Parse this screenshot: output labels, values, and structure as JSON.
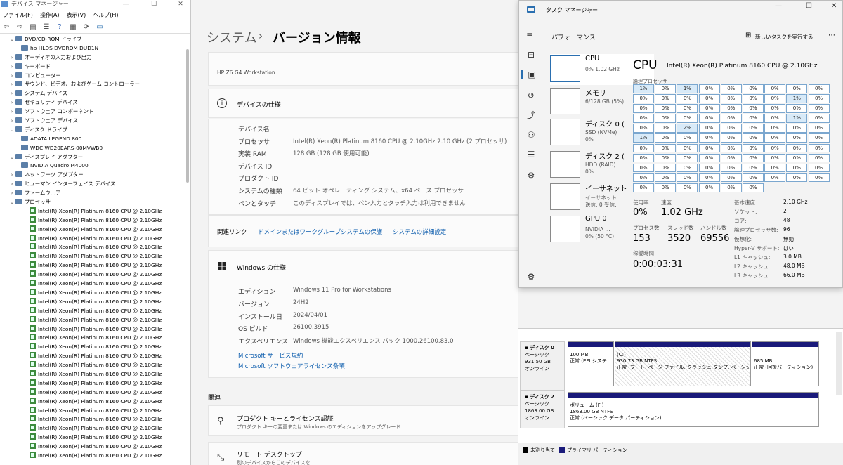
{
  "device_manager": {
    "title": "デバイス マネージャー",
    "menu": [
      "ファイル(F)",
      "操作(A)",
      "表示(V)",
      "ヘルプ(H)"
    ],
    "tree": [
      {
        "label": "DVD/CD-ROM ドライブ",
        "level": 0,
        "expanded": true
      },
      {
        "label": "hp HLDS DVDROM DUD1N",
        "level": 1
      },
      {
        "label": "オーディオの入力および出力",
        "level": 0
      },
      {
        "label": "キーボード",
        "level": 0
      },
      {
        "label": "コンピューター",
        "level": 0
      },
      {
        "label": "サウンド、ビデオ、およびゲーム コントローラー",
        "level": 0
      },
      {
        "label": "システム デバイス",
        "level": 0
      },
      {
        "label": "セキュリティ デバイス",
        "level": 0
      },
      {
        "label": "ソフトウェア コンポーネント",
        "level": 0
      },
      {
        "label": "ソフトウェア デバイス",
        "level": 0
      },
      {
        "label": "ディスク ドライブ",
        "level": 0,
        "expanded": true
      },
      {
        "label": "ADATA LEGEND 800",
        "level": 1
      },
      {
        "label": "WDC WD20EARS-00MVWB0",
        "level": 1
      },
      {
        "label": "ディスプレイ アダプター",
        "level": 0,
        "expanded": true
      },
      {
        "label": "NVIDIA Quadro M4000",
        "level": 1
      },
      {
        "label": "ネットワーク アダプター",
        "level": 0
      },
      {
        "label": "ヒューマン インターフェイス デバイス",
        "level": 0
      },
      {
        "label": "ファームウェア",
        "level": 0
      },
      {
        "label": "プロセッサ",
        "level": 0,
        "expanded": true
      }
    ],
    "cpu_label": "Intel(R) Xeon(R) Platinum 8160 CPU @ 2.10GHz",
    "cpu_count": 28
  },
  "settings": {
    "breadcrumb_parent": "システム",
    "breadcrumb_sep": "›",
    "breadcrumb_current": "バージョン情報",
    "model": "HP Z6 G4 Workstation",
    "device_spec_title": "デバイスの仕様",
    "device_specs": [
      {
        "label": "デバイス名",
        "value": ""
      },
      {
        "label": "プロセッサ",
        "value": "Intel(R) Xeon(R) Platinum 8160 CPU @ 2.10GHz   2.10 GHz  (2 プロセッサ)"
      },
      {
        "label": "実装 RAM",
        "value": "128 GB (128 GB 使用可能)"
      },
      {
        "label": "デバイス ID",
        "value": ""
      },
      {
        "label": "プロダクト ID",
        "value": ""
      },
      {
        "label": "システムの種類",
        "value": "64 ビット オペレーティング システム、x64 ベース プロセッサ"
      },
      {
        "label": "ペンとタッチ",
        "value": "このディスプレイでは、ペン入力とタッチ入力は利用できません"
      }
    ],
    "related_links_label": "関連リンク",
    "related_links": [
      "ドメインまたはワークグループ",
      "システムの保護",
      "システムの詳細設定"
    ],
    "windows_spec_title": "Windows の仕様",
    "windows_specs": [
      {
        "label": "エディション",
        "value": "Windows 11 Pro for Workstations"
      },
      {
        "label": "バージョン",
        "value": "24H2"
      },
      {
        "label": "インストール日",
        "value": "2024/04/01"
      },
      {
        "label": "OS ビルド",
        "value": "26100.3915"
      },
      {
        "label": "エクスペリエンス",
        "value": "Windows 機能エクスペリエンス パック 1000.26100.83.0"
      }
    ],
    "ms_links": [
      "Microsoft サービス規約",
      "Microsoft ソフトウェアライセンス条項"
    ],
    "related_heading": "関連",
    "product_key_title": "プロダクト キーとライセンス認証",
    "product_key_sub": "プロダクト キーの変更または Windows のエディションをアップグレード",
    "remote_title": "リモート デスクトップ",
    "remote_sub": "別のデバイスからこのデバイスを"
  },
  "task_manager": {
    "title": "タスク マネージャー",
    "page": "パフォーマンス",
    "run_task": "新しいタスクを実行する",
    "items": [
      {
        "name": "CPU",
        "sub1": "0%  1.02 GHz",
        "sub2": ""
      },
      {
        "name": "メモリ",
        "sub1": "6/128 GB (5%)",
        "sub2": ""
      },
      {
        "name": "ディスク 0 (",
        "sub1": "SSD (NVMe)",
        "sub2": "0%"
      },
      {
        "name": "ディスク 2 (",
        "sub1": "HDD (RAID)",
        "sub2": "0%"
      },
      {
        "name": "イーサネット",
        "sub1": "イーサネット",
        "sub2": "送信: 0 受信:"
      },
      {
        "name": "GPU 0",
        "sub1": "NVIDIA ...",
        "sub2": "0% (50 °C)"
      }
    ],
    "cpu_title": "CPU",
    "cpu_model": "Intel(R) Xeon(R) Platinum 8160 CPU @ 2.10GHz",
    "logical_label": "論理プロセッサ",
    "grid": [
      "1%",
      "0%",
      "1%",
      "0%",
      "0%",
      "0%",
      "0%",
      "0%",
      "0%",
      "0%",
      "0%",
      "0%",
      "0%",
      "0%",
      "0%",
      "0%",
      "1%",
      "0%",
      "0%",
      "0%",
      "0%",
      "0%",
      "0%",
      "0%",
      "0%",
      "0%",
      "0%",
      "0%",
      "0%",
      "0%",
      "0%",
      "0%",
      "0%",
      "0%",
      "1%",
      "0%",
      "0%",
      "0%",
      "2%",
      "0%",
      "0%",
      "0%",
      "0%",
      "0%",
      "0%",
      "1%",
      "0%",
      "0%",
      "0%",
      "0%",
      "0%",
      "0%",
      "0%",
      "0%",
      "0%",
      "0%",
      "0%",
      "0%",
      "0%",
      "0%",
      "0%",
      "0%",
      "0%",
      "0%",
      "0%",
      "0%",
      "0%",
      "0%",
      "0%",
      "0%",
      "0%",
      "0%",
      "0%",
      "0%",
      "0%",
      "0%",
      "0%",
      "0%",
      "0%",
      "0%",
      "0%",
      "0%",
      "0%",
      "0%",
      "0%",
      "0%",
      "0%",
      "0%",
      "0%",
      "0%",
      "0%",
      "0%",
      "0%",
      "0%",
      "0%",
      "0%"
    ],
    "util_label": "使用率",
    "util": "0%",
    "speed_label": "速度",
    "speed": "1.02 GHz",
    "proc_label": "プロセス数",
    "proc": "153",
    "thread_label": "スレッド数",
    "thread": "3520",
    "handle_label": "ハンドル数",
    "handle": "69556",
    "uptime_label": "稼働時間",
    "uptime": "0:00:03:31",
    "details": [
      {
        "k": "基本速度:",
        "v": "2.10 GHz"
      },
      {
        "k": "ソケット:",
        "v": "2"
      },
      {
        "k": "コア:",
        "v": "48"
      },
      {
        "k": "論理プロセッサ数:",
        "v": "96"
      },
      {
        "k": "仮想化:",
        "v": "無効"
      },
      {
        "k": "Hyper-V サポート:",
        "v": "はい"
      },
      {
        "k": "L1 キャッシュ:",
        "v": "3.0 MB"
      },
      {
        "k": "L2 キャッシュ:",
        "v": "48.0 MB"
      },
      {
        "k": "L3 キャッシュ:",
        "v": "66.0 MB"
      }
    ]
  },
  "disk": {
    "d0_name": "ディスク 0",
    "d0_type": "ベーシック",
    "d0_size": "931.50 GB",
    "d0_state": "オンライン",
    "p1_size": "100 MB",
    "p1_desc": "正常 (EFI システ",
    "p2_name": "(C:)",
    "p2_size": "930.73 GB NTFS",
    "p2_desc": "正常 (ブート, ページ ファイル, クラッシュ ダンプ, ベーシック",
    "p3_size": "685 MB",
    "p3_desc": "正常 (回復パーティション)",
    "d2_name": "ディスク 2",
    "d2_type": "ベーシック",
    "d2_size": "1863.00 GB",
    "d2_state": "オンライン",
    "vol_name": "ボリューム (F:)",
    "vol_size": "1863.00 GB NTFS",
    "vol_desc": "正常 (ベーシック データ パーティション)",
    "legend_unalloc": "未割り当て",
    "legend_primary": "プライマリ パーティション"
  }
}
